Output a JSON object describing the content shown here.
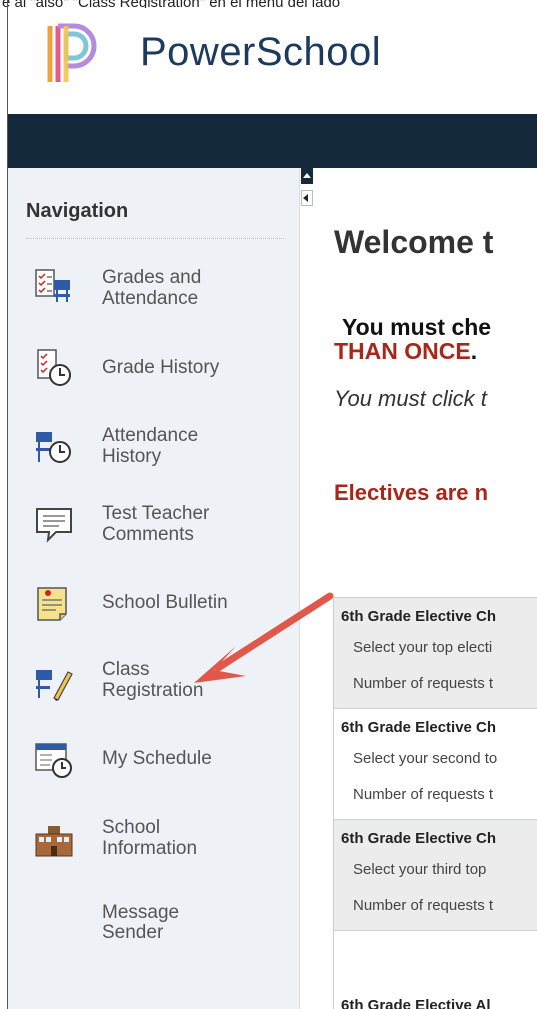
{
  "caption": "e al \"also\" \"Class Registration\" en el menu del lado",
  "brand": {
    "name": "PowerSchool"
  },
  "navigation": {
    "title": "Navigation",
    "items": [
      {
        "id": "grades",
        "line1": "Grades and",
        "line2": "Attendance",
        "icon": "grades-attendance-icon"
      },
      {
        "id": "grade-history",
        "line1": "Grade History",
        "line2": "",
        "icon": "grade-history-icon"
      },
      {
        "id": "attendance-history",
        "line1": "Attendance",
        "line2": "History",
        "icon": "attendance-history-icon"
      },
      {
        "id": "teacher-comments",
        "line1": "Test Teacher",
        "line2": "Comments",
        "icon": "speech-bubble-icon"
      },
      {
        "id": "school-bulletin",
        "line1": "School Bulletin",
        "line2": "",
        "icon": "bulletin-icon"
      },
      {
        "id": "class-registration",
        "line1": "Class",
        "line2": "Registration",
        "icon": "class-registration-icon"
      },
      {
        "id": "my-schedule",
        "line1": "My Schedule",
        "line2": "",
        "icon": "schedule-icon"
      },
      {
        "id": "school-information",
        "line1": "School",
        "line2": "Information",
        "icon": "school-building-icon"
      },
      {
        "id": "message-sender",
        "line1": "Message",
        "line2": "Sender",
        "icon": ""
      }
    ]
  },
  "main": {
    "welcome": "Welcome t",
    "must_line": "You must che",
    "than_once": "THAN ONCE",
    "than_once_tail": ".",
    "click_line": "You must click t",
    "electives": "Electives are n"
  },
  "requests": [
    {
      "heading": "6th Grade Elective Ch",
      "row1": "Select your top electi",
      "row2": "Number of requests t"
    },
    {
      "heading": "6th Grade Elective Ch",
      "row1": "Select your second to",
      "row2": "Number of requests t"
    },
    {
      "heading": "6th Grade Elective Ch",
      "row1": "Select your third top",
      "row2": "Number of requests t"
    },
    {
      "heading": "6th Grade Elective Al",
      "row1": "",
      "row2": ""
    }
  ],
  "colors": {
    "topbar": "#15293d",
    "sidebar_bg": "#eef2f7",
    "warning_red": "#a8261a",
    "annotation_arrow": "#e0584a"
  }
}
